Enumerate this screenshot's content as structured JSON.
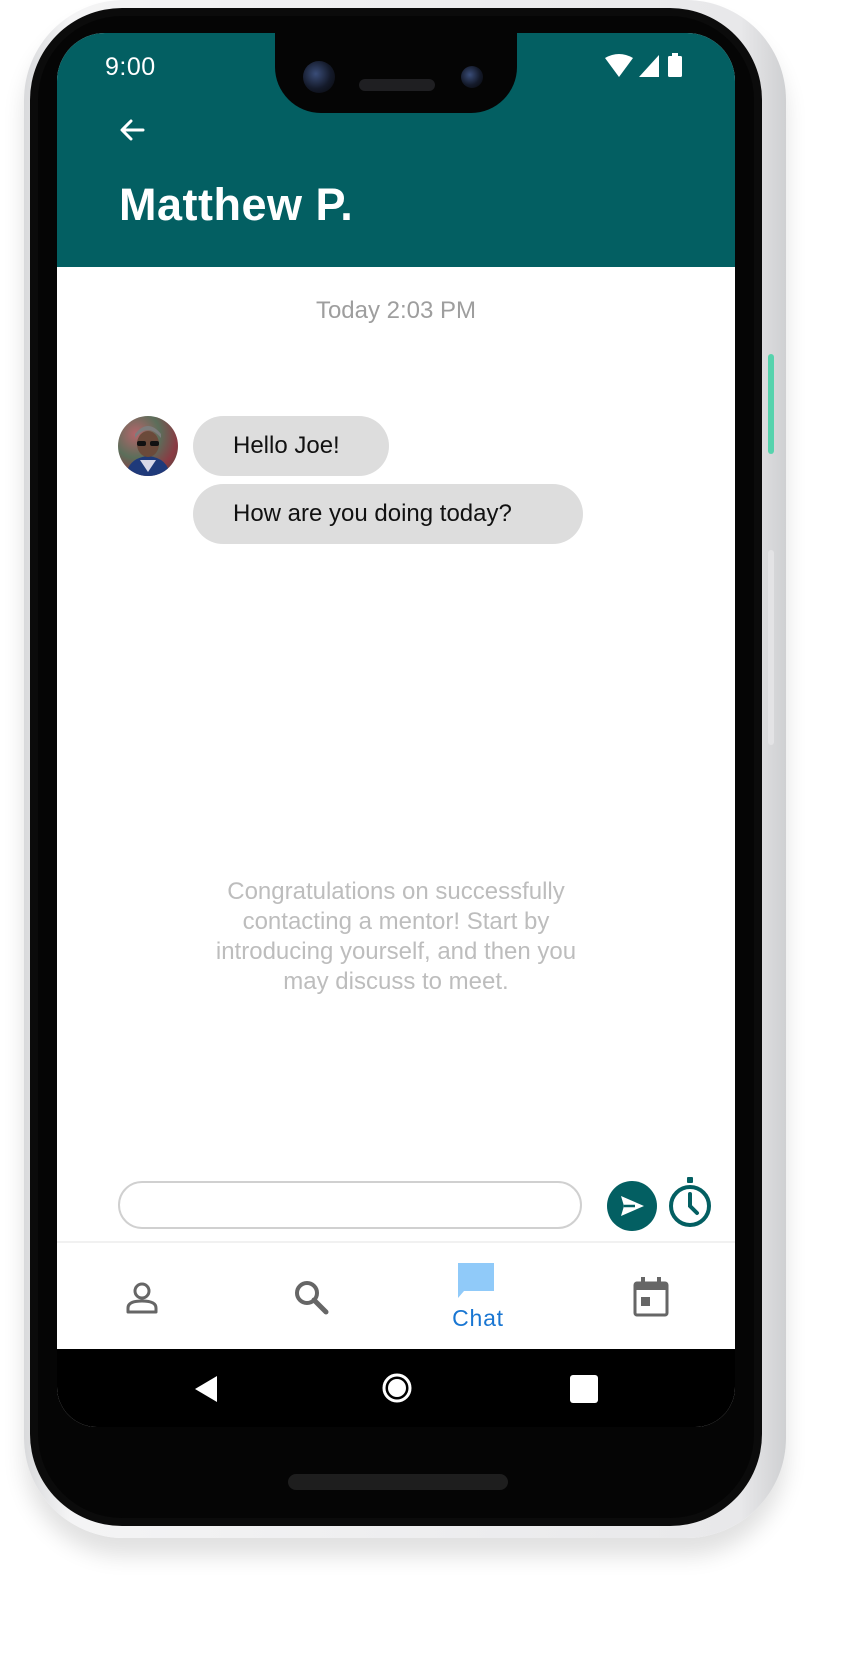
{
  "status_bar": {
    "time": "9:00"
  },
  "header": {
    "title": "Matthew P."
  },
  "chat": {
    "timestamp": "Today 2:03 PM",
    "messages": [
      {
        "text": "Hello Joe!"
      },
      {
        "text": "How are you doing today?"
      }
    ],
    "hint": "Congratulations on successfully contacting a mentor! Start by introducing yourself, and then you may discuss to meet."
  },
  "composer": {
    "value": "",
    "placeholder": ""
  },
  "bottom_nav": {
    "items": [
      {
        "icon": "profile-icon",
        "label": ""
      },
      {
        "icon": "search-icon",
        "label": ""
      },
      {
        "icon": "chat-icon",
        "label": "Chat",
        "active": true
      },
      {
        "icon": "calendar-icon",
        "label": ""
      }
    ]
  },
  "colors": {
    "header": "#035f62",
    "accent": "#1976d2",
    "bubble": "#dddddd",
    "hint_text": "#bdbdbd"
  }
}
